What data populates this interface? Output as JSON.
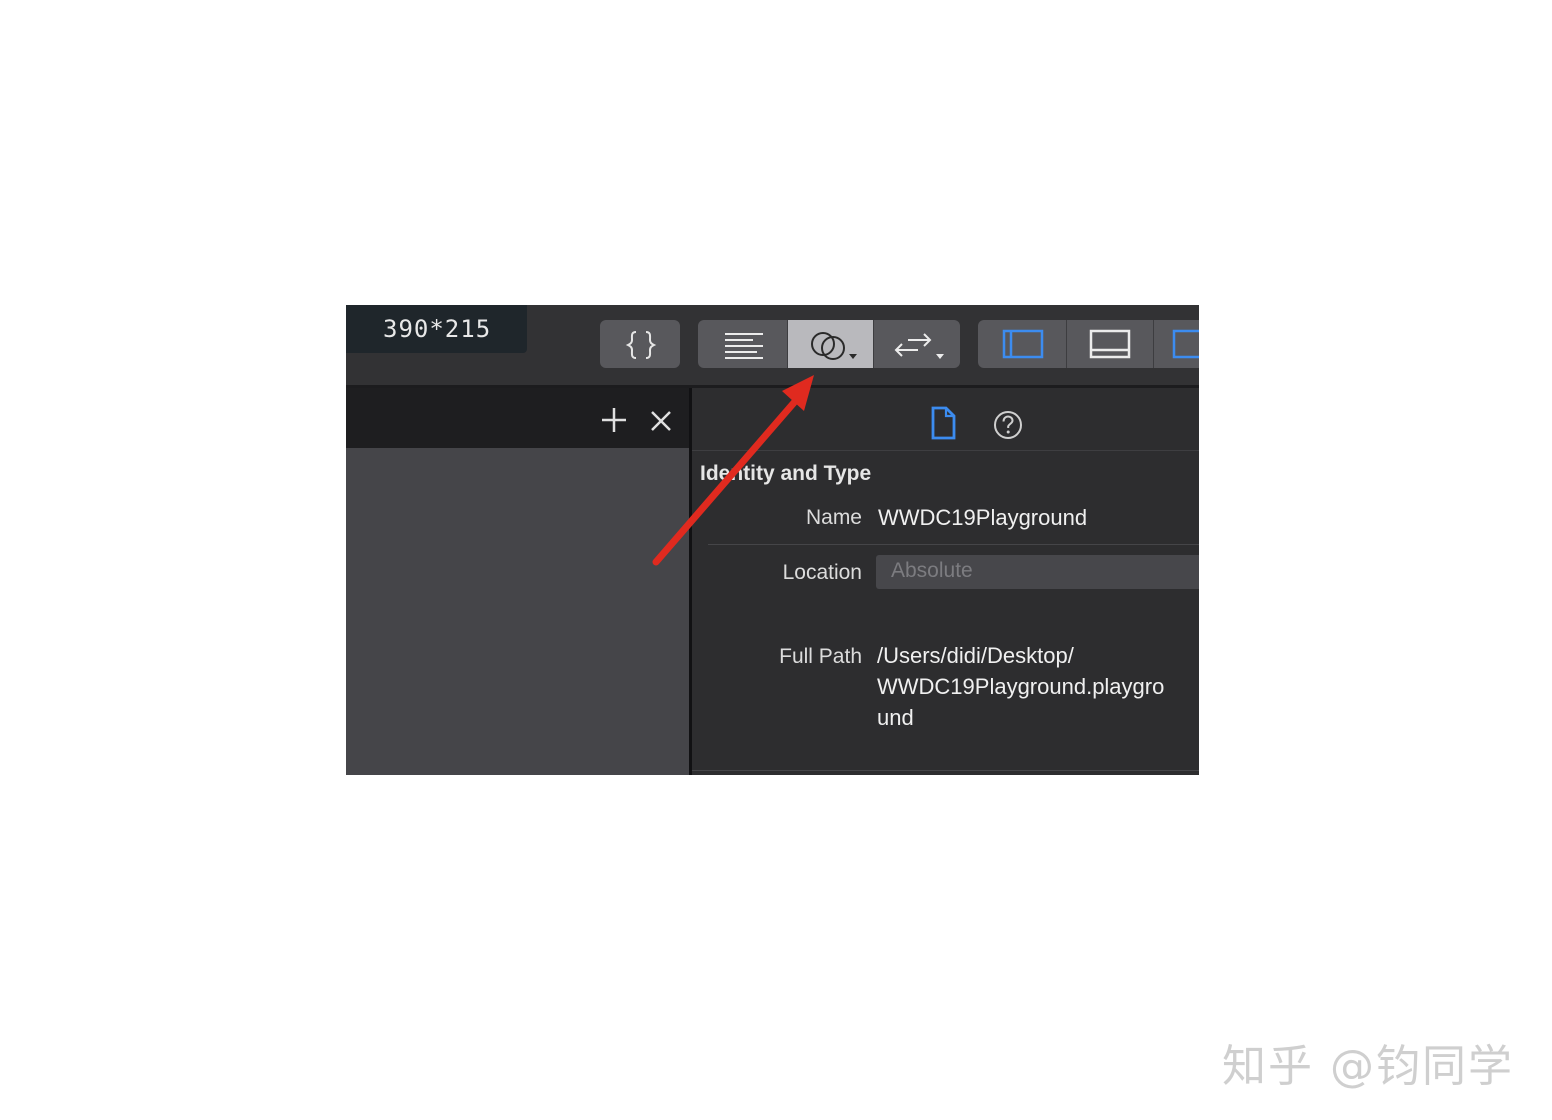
{
  "toolbar": {
    "size_badge": "390*215",
    "buttons": [
      {
        "name": "code-snippet",
        "icon": "braces-icon"
      },
      {
        "name": "standard-editor",
        "icon": "lines-icon"
      },
      {
        "name": "assistant-editor",
        "icon": "overlapping-circles-icon",
        "active": true
      },
      {
        "name": "version-editor",
        "icon": "arrows-icon"
      }
    ],
    "layout_buttons": [
      "left-panel-icon",
      "bottom-panel-icon",
      "right-panel-icon"
    ]
  },
  "left_panel": {
    "add_icon": "plus-icon",
    "close_icon": "close-icon"
  },
  "inspector": {
    "tabs": [
      "file-icon",
      "help-icon"
    ],
    "section_title": "Identity and Type",
    "name_label": "Name",
    "name_value": "WWDC19Playground",
    "location_label": "Location",
    "location_value": "Absolute",
    "full_path_label": "Full Path",
    "full_path_lines": [
      "/Users/didi/Desktop/",
      "WWDC19Playground.playgro",
      "und"
    ]
  },
  "colors": {
    "accent_blue": "#3c8cf0",
    "annotation_arrow": "#e02a1f"
  },
  "watermark": "知乎 @钧同学"
}
